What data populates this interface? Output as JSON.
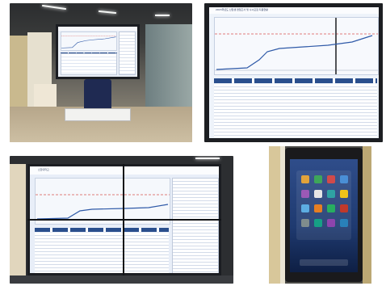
{
  "panels": [
    {
      "caption": "",
      "alt": "Kiosk displaying a line chart and data tables in a building lobby"
    },
    {
      "caption": "",
      "alt": "Close-up of a wide screen showing a line chart with a rising series and a flat reference line"
    },
    {
      "caption": "",
      "alt": "Video wall of four screens showing the same chart and tables"
    },
    {
      "caption": "",
      "alt": "Vertical touchscreen kiosk showing an application launcher grid"
    }
  ],
  "screen_texts": {
    "logo_label": "신한대학교",
    "chart_title": "2015학년도 신입생 면접고사 및 수시모집 지원현황"
  },
  "colors": {
    "series_line": "#2f5aa8",
    "reference_line": "#d9534f",
    "table_header": "#2a4f8d"
  },
  "icons": [
    "chart-line-icon",
    "table-icon",
    "kiosk-icon",
    "app-grid-icon"
  ]
}
